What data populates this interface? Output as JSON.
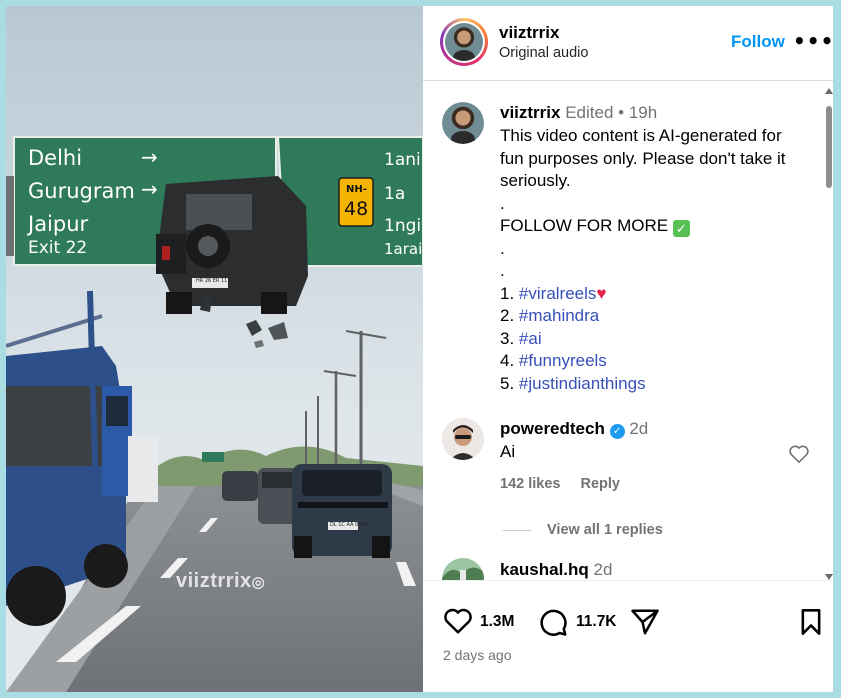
{
  "video": {
    "watermark": "viiztrrix",
    "sign": {
      "left_lines": [
        "Delhi",
        "Gurugram",
        "Jaipur",
        "Exit 22"
      ],
      "right_lines": [
        "1ani",
        "1a",
        "1ngi",
        "1arai"
      ],
      "route_shield": [
        "NH-",
        "48"
      ]
    },
    "plates": {
      "jeep": "HR 26 ER 1111",
      "suv": "DL 1C AA 0000"
    }
  },
  "header": {
    "username": "viiztrrix",
    "audio": "Original audio",
    "follow_label": "Follow",
    "more_label": "•••"
  },
  "caption": {
    "username": "viiztrrix",
    "edited": "Edited",
    "separator": "•",
    "time": "19h",
    "lines": [
      "This video content is AI-generated for",
      "fun purposes only. Please don't take it",
      "seriously.",
      ".",
      "FOLLOW FOR MORE",
      ".",
      "."
    ],
    "hashtags": [
      {
        "num": "1.",
        "tag": "#viralreels"
      },
      {
        "num": "2.",
        "tag": "#mahindra"
      },
      {
        "num": "3.",
        "tag": "#ai"
      },
      {
        "num": "4.",
        "tag": "#funnyreels"
      },
      {
        "num": "5.",
        "tag": "#justindianthings"
      }
    ]
  },
  "comments": [
    {
      "username": "poweredtech",
      "verified": true,
      "time": "2d",
      "text": "Ai",
      "likes": "142 likes",
      "reply_label": "Reply",
      "view_replies": "View all 1 replies"
    },
    {
      "username": "kaushal.hq",
      "time": "2d"
    }
  ],
  "footer": {
    "likes_count": "1.3M",
    "comments_count": "11.7K",
    "timestamp": "2 days ago"
  },
  "colors": {
    "accent": "#0095f6",
    "hashtag": "#3750b8",
    "muted": "#737373",
    "sign_green": "#2f7a5a",
    "border": "#a9dde3"
  }
}
